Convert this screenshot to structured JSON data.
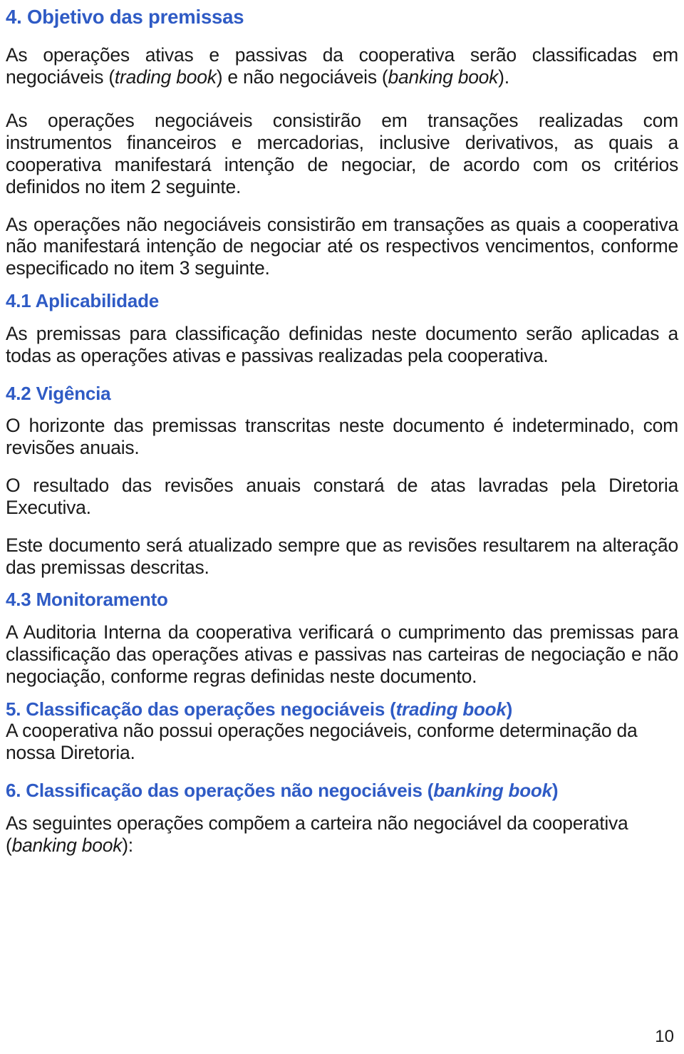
{
  "document": {
    "page_number": "10",
    "heading_color": "#2f5bc5",
    "sections": [
      {
        "id": "objetivo",
        "heading": "4. Objetivo das premissas",
        "paragraphs": [
          "As operações ativas e passivas da cooperativa serão classificadas em negociáveis (trading book) e não negociáveis (banking book).",
          "As operações negociáveis consistirão em transações realizadas com instrumentos financeiros e mercadorias, inclusive derivativos, as quais a cooperativa manifestará intenção de negociar, de acordo com os critérios definidos no item 2 seguinte.",
          "As operações não negociáveis consistirão em transações as quais a cooperativa não manifestará intenção de negociar até os respectivos vencimentos, conforme especificado no item 3 seguinte."
        ]
      },
      {
        "id": "aplicabilidade",
        "heading": "4.1 Aplicabilidade",
        "paragraphs": [
          "As premissas para classificação definidas neste documento serão aplicadas a todas as operações ativas e passivas realizadas pela cooperativa."
        ]
      },
      {
        "id": "vigencia",
        "heading": "4.2 Vigência",
        "paragraphs": [
          "O horizonte das premissas transcritas neste documento é indeterminado, com revisões anuais.",
          "O resultado das revisões anuais constará de atas lavradas pela Diretoria Executiva.",
          "Este documento será atualizado sempre que as revisões resultarem na alteração das premissas descritas."
        ]
      },
      {
        "id": "monitoramento",
        "heading": "4.3 Monitoramento",
        "paragraphs": [
          "A Auditoria Interna da cooperativa verificará o cumprimento das premissas para classificação das operações ativas e passivas nas carteiras de negociação e não negociação, conforme regras definidas neste documento."
        ]
      },
      {
        "id": "classificacao-negociaveis",
        "heading_parts": {
          "prefix": "5. Classificação das operações negociáveis (",
          "italic": "trading book",
          "suffix": ")"
        },
        "paragraphs": [
          "A cooperativa não possui operações negociáveis, conforme determinação da nossa Diretoria."
        ]
      },
      {
        "id": "classificacao-nao-negociaveis",
        "heading_parts": {
          "prefix": "6. Classificação das operações não negociáveis (",
          "italic": "banking book",
          "suffix": ")"
        },
        "paragraphs": []
      }
    ],
    "closing_paragraph": {
      "line_a": "As seguintes operações compõem a carteira não negociável da cooperativa",
      "line_b_open": "(",
      "line_b_italic": "banking book",
      "line_b_close": "):"
    },
    "inline_italics": {
      "trading_book": "trading book",
      "banking_book": "banking book"
    },
    "paragraph_fragments": {
      "p1_a": "As operações ativas e passivas da cooperativa serão classificadas em negociáveis (",
      "p1_b": ") e não negociáveis (",
      "p1_c": ")."
    }
  }
}
